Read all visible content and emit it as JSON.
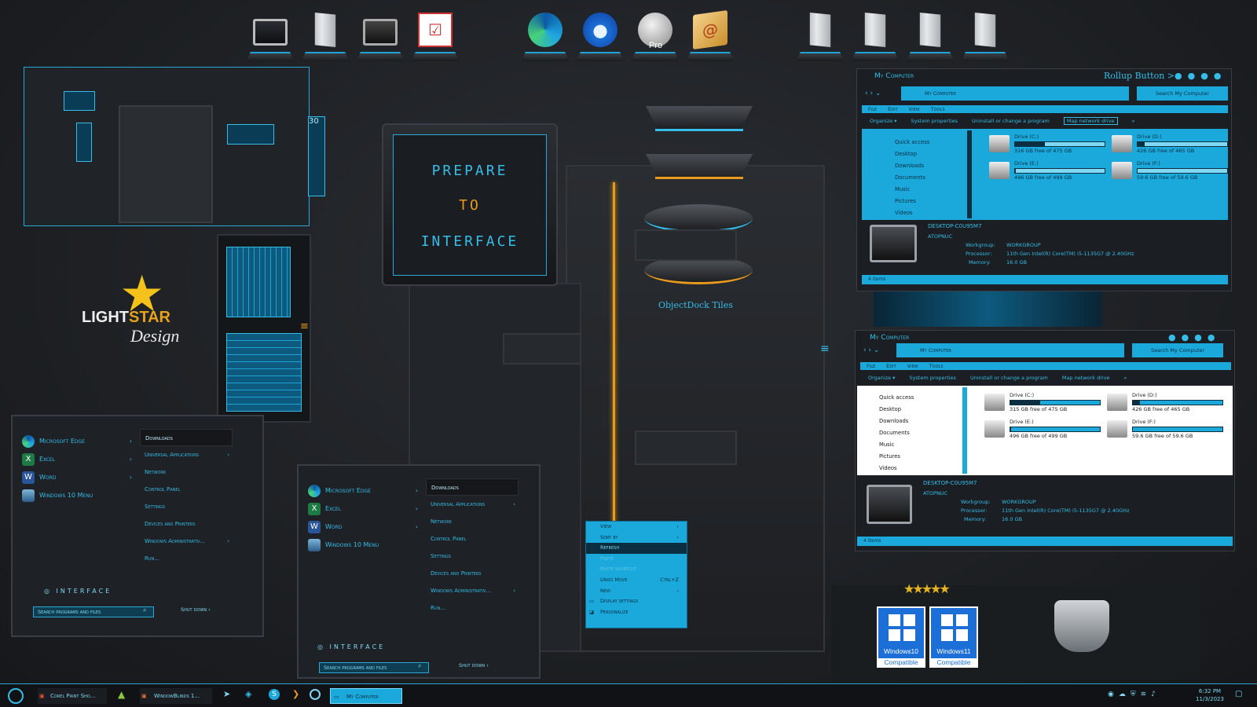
{
  "dock": {
    "ic_monitor_label": "",
    "ic_maps_label": "Pro"
  },
  "monitor": {
    "line1": "PREPARE",
    "line2": "TO",
    "line3": "INTERFACE"
  },
  "objectdock": {
    "caption": "ObjectDock Tiles"
  },
  "brand": {
    "name1": "LIGHT",
    "name2": "STAR",
    "design": "Design"
  },
  "compat": {
    "win10": "Windows10",
    "win11": "Windows11",
    "compat": "Compatible"
  },
  "startmenu1": {
    "left": [
      "Microsoft Edge",
      "Excel",
      "Word",
      "Windows 10 Menu"
    ],
    "right": [
      "Downloads",
      "Universal Applications",
      "Network",
      "Control Panel",
      "Settings",
      "Devices and Printers",
      "Windows Administrativ...",
      "Run..."
    ],
    "logo": "INTERFACE",
    "search": "Search programs and files",
    "shutdown": "Shut down"
  },
  "startmenu2": {
    "left": [
      "Microsoft Edge",
      "Excel",
      "Word",
      "Windows 10 Menu"
    ],
    "right": [
      "Downloads",
      "Universal Applications",
      "Network",
      "Control Panel",
      "Settings",
      "Devices and Printers",
      "Windows Administrativ...",
      "Run..."
    ],
    "logo": "INTERFACE",
    "search": "Search programs and files",
    "shutdown": "Shut down"
  },
  "explorer1": {
    "title": "My Computer",
    "rollup": "Rollup Button >",
    "address": "My Computer",
    "search": "Search My Computer",
    "menu": [
      "File",
      "Edit",
      "View",
      "Tools"
    ],
    "toolbar": [
      "Organize ▾",
      "System properties",
      "Uninstall or change a program",
      "Map network drive",
      "»"
    ],
    "nav": [
      "Quick access",
      "Desktop",
      "Downloads",
      "Documents",
      "Music",
      "Pictures",
      "Videos"
    ],
    "drives": [
      {
        "name": "Drive (C:)",
        "free": "316 GB free of 475 GB",
        "used": 0.33
      },
      {
        "name": "Drive (D:)",
        "free": "426 GB free of 465 GB",
        "used": 0.08
      },
      {
        "name": "Drive (E:)",
        "free": "496 GB free of 499 GB",
        "used": 0.01
      },
      {
        "name": "Drive (F:)",
        "free": "59.6 GB free of 59.6 GB",
        "used": 0.0
      }
    ],
    "pcname": "DESKTOP-C0U95M7",
    "user": "ATOPNUC",
    "workgroup_label": "Workgroup:",
    "workgroup": "WORKGROUP",
    "processor_label": "Processor:",
    "processor": "11th Gen Intel(R) Core(TM) i5-1135G7 @ 2.40GHz",
    "memory_label": "Memory:",
    "memory": "16.0 GB",
    "status": "4 items"
  },
  "explorer2": {
    "title": "My Computer",
    "address": "My Computer",
    "search": "Search My Computer",
    "menu": [
      "File",
      "Edit",
      "View",
      "Tools"
    ],
    "toolbar": [
      "Organize ▾",
      "System properties",
      "Uninstall or change a program",
      "Map network drive",
      "»"
    ],
    "nav": [
      "Quick access",
      "Desktop",
      "Downloads",
      "Documents",
      "Music",
      "Pictures",
      "Videos"
    ],
    "drives": [
      {
        "name": "Drive (C:)",
        "free": "315 GB free of 475 GB",
        "used": 0.33
      },
      {
        "name": "Drive (D:)",
        "free": "426 GB free of 465 GB",
        "used": 0.08
      },
      {
        "name": "Drive (E:)",
        "free": "496 GB free of 499 GB",
        "used": 0.01
      },
      {
        "name": "Drive (F:)",
        "free": "59.6 GB free of 59.6 GB",
        "used": 0.0
      }
    ],
    "pcname": "DESKTOP-C0U95M7",
    "user": "ATOPNUC",
    "workgroup_label": "Workgroup:",
    "workgroup": "WORKGROUP",
    "processor_label": "Processor:",
    "processor": "11th Gen Intel(R) Core(TM) i5-1135G7 @ 2.40GHz",
    "memory_label": "Memory:",
    "memory": "16.0 GB",
    "status": "4 items"
  },
  "context": {
    "items": [
      {
        "label": "View",
        "arrow": "›"
      },
      {
        "label": "Sort by",
        "arrow": "›"
      },
      {
        "label": "Refresh",
        "selected": true
      },
      {
        "label": "Paste",
        "disabled": true
      },
      {
        "label": "Paste shortcut",
        "disabled": true
      },
      {
        "label": "Undo Move",
        "key": "Ctrl+Z"
      },
      {
        "label": "New",
        "arrow": "›"
      },
      {
        "label": "Display settings"
      },
      {
        "label": "Personalize"
      }
    ]
  },
  "taskbar": {
    "items": [
      "Corel Paint Sho...",
      "WindowBlinds 1...",
      "My Computer"
    ],
    "time": "6:32 PM",
    "date": "11/3/2023"
  },
  "colors": {
    "accent": "#1ba9dc",
    "orange": "#f0a020",
    "bg": "#1d2024"
  }
}
